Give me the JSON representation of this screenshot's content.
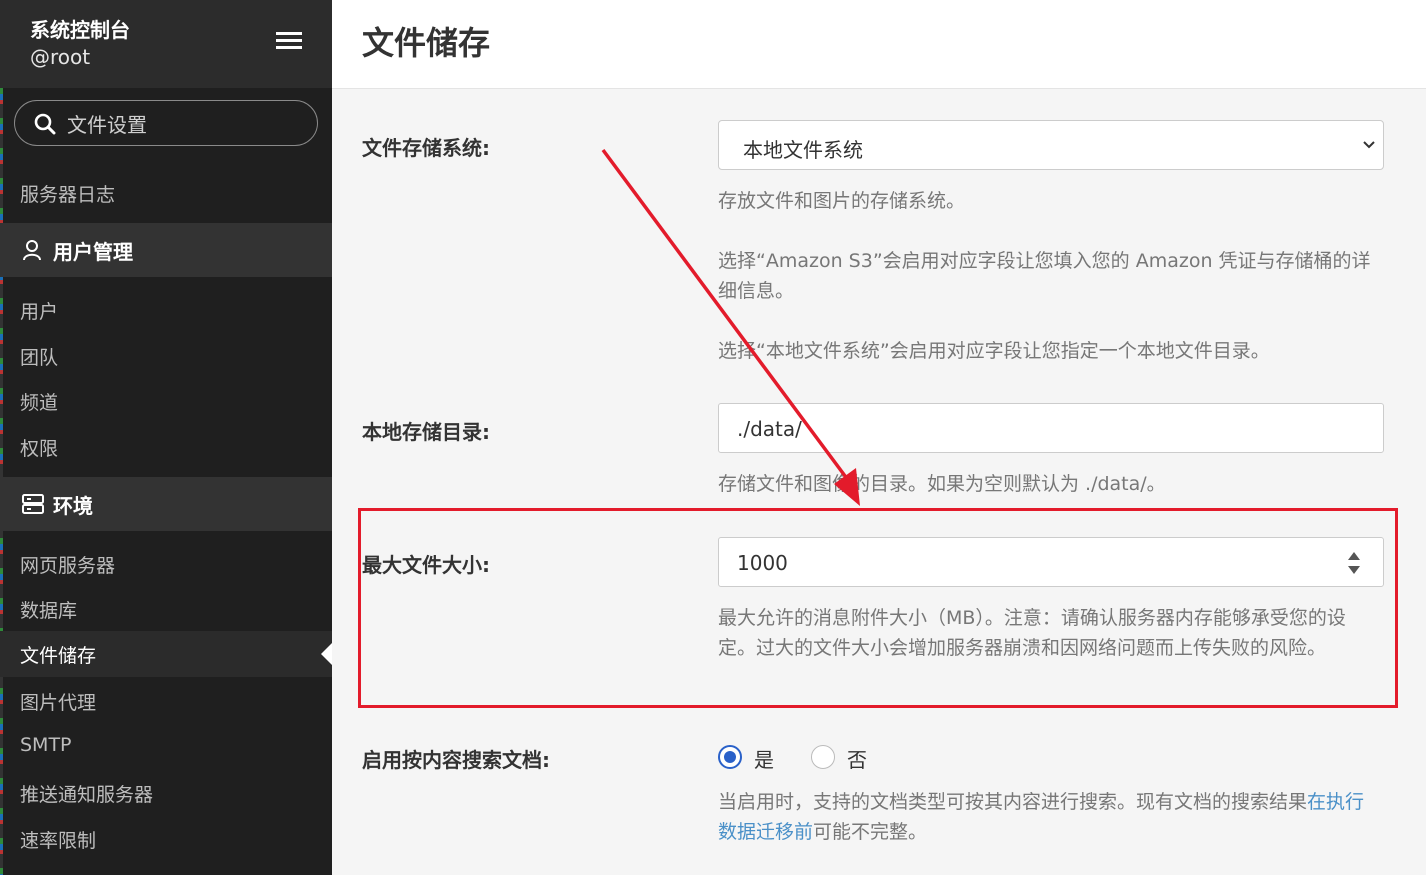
{
  "sidebar": {
    "title": "系统控制台",
    "user": "@root",
    "search_value": "文件设置",
    "items_top": [
      "服务器日志"
    ],
    "section_users": "用户管理",
    "users_items": [
      "用户",
      "团队",
      "频道",
      "权限"
    ],
    "section_env": "环境",
    "env_items": [
      "网页服务器",
      "数据库",
      "文件储存",
      "图片代理",
      "SMTP",
      "推送通知服务器",
      "速率限制"
    ],
    "active_item": "文件储存"
  },
  "page": {
    "title": "文件储存",
    "storage_label": "文件存储系统:",
    "storage_value": "本地文件系统",
    "storage_help_1": "存放文件和图片的存储系统。",
    "storage_help_2": "选择“Amazon S3”会启用对应字段让您填入您的 Amazon 凭证与存储桶的详细信息。",
    "storage_help_3": "选择“本地文件系统”会启用对应字段让您指定一个本地文件目录。",
    "dir_label": "本地存储目录:",
    "dir_value": "./data/",
    "dir_help": "存储文件和图像的目录。如果为空则默认为 ./data/。",
    "maxsize_label": "最大文件大小:",
    "maxsize_value": "1000",
    "maxsize_help": "最大允许的消息附件大小（MB）。注意：请确认服务器内存能够承受您的设定。过大的文件大小会增加服务器崩溃和因网络问题而上传失败的风险。",
    "search_label": "启用按内容搜索文档:",
    "radio_yes": "是",
    "radio_no": "否",
    "radio_selected": "是",
    "search_help_prefix": "当启用时，支持的文档类型可按其内容进行搜索。现有文档的搜索结果",
    "search_help_link": "在执行数据迁移前",
    "search_help_suffix": "可能不完整。"
  },
  "colors": {
    "sidebar_bg": "#1f1f1f",
    "annotation_red": "#e31b2b",
    "radio_blue": "#2a61c9",
    "link_blue": "#4a90c8"
  }
}
